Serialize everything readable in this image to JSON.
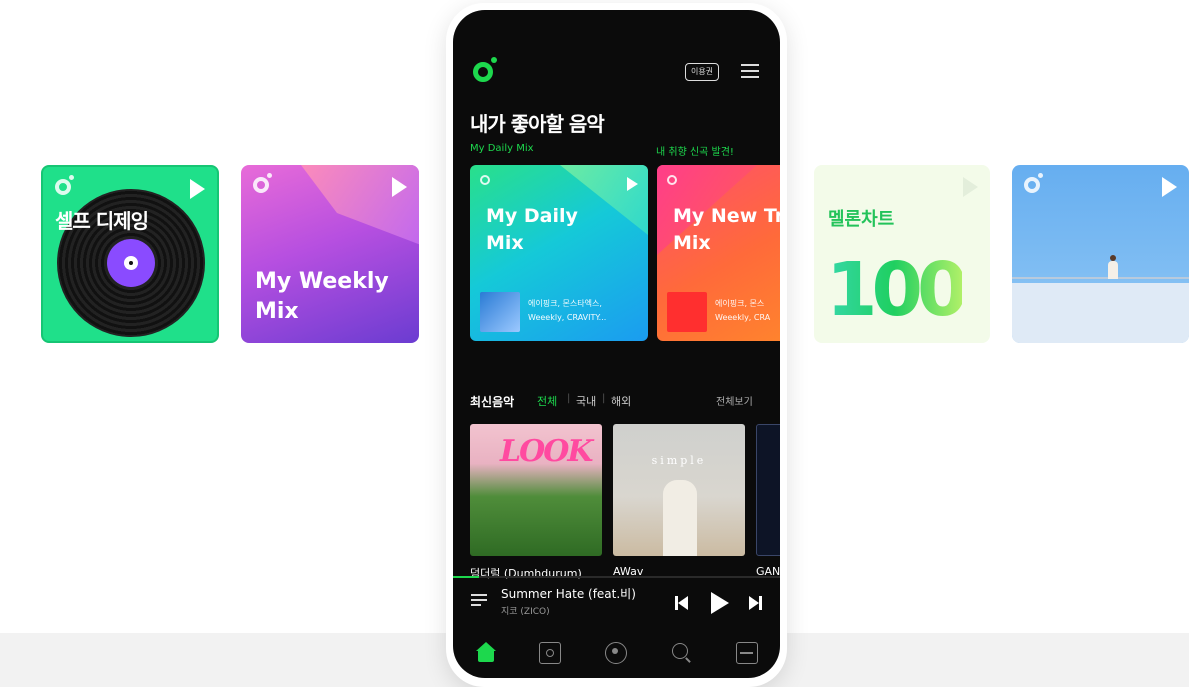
{
  "side_cards": {
    "self_dj": {
      "title": "셀프 디제잉",
      "icon": "vinyl-record-icon"
    },
    "weekly_mix": {
      "title_line1": "My Weekly",
      "title_line2": "Mix"
    },
    "melon_chart": {
      "title": "멜론차트",
      "number": "100"
    },
    "scene": {
      "description_icon": "illustration-rooftop"
    }
  },
  "app": {
    "header": {
      "ticket_label": "이용권"
    },
    "section": {
      "title": "내가 좋아할 음악",
      "sub_left": "My Daily Mix",
      "sub_right": "내 취향 신곡 발견!"
    },
    "mixes": [
      {
        "title_line1": "My Daily",
        "title_line2": "Mix",
        "artists_line1": "에이핑크, 몬스타엑스,",
        "artists_line2": "Weeekly, CRAVITY..."
      },
      {
        "title_line1": "My New Tr",
        "title_line2": "Mix",
        "artists_line1": "에이핑크, 몬스",
        "artists_line2": "Weeekly, CRA"
      }
    ],
    "latest": {
      "heading": "최신음악",
      "tab_all": "전체",
      "tab_domestic": "국내",
      "tab_foreign": "해외",
      "separator": "|",
      "view_all": "전체보기",
      "albums": [
        {
          "cover_text": "LOOK",
          "caption": "덤더럼 (Dumhdurum)"
        },
        {
          "cover_text": "simple",
          "caption": "AWav"
        },
        {
          "cover_text": "",
          "caption": "GAN"
        }
      ]
    },
    "now_playing": {
      "title": "Summer Hate (feat.비)",
      "artist": "지코 (ZICO)",
      "progress": 0.08
    },
    "nav": [
      "home-icon",
      "library-icon",
      "podcast-icon",
      "search-icon",
      "more-icon"
    ]
  },
  "colors": {
    "brand_green": "#1dd84d",
    "screen_bg": "#0b0b0b"
  }
}
